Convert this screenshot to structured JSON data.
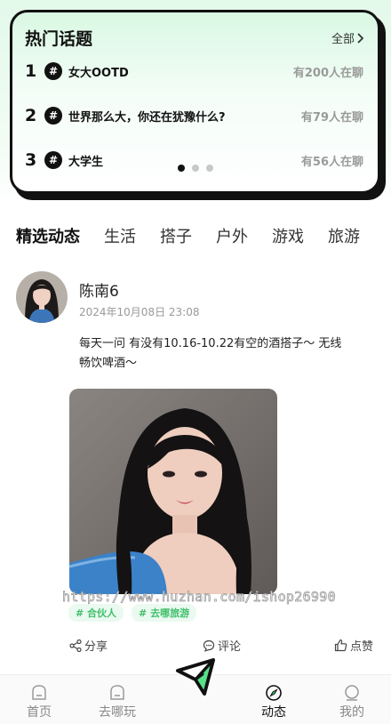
{
  "hot_topics": {
    "title": "热门话题",
    "all_label": "全部",
    "items": [
      {
        "rank": "1",
        "hash": "#",
        "name": "女大OOTD",
        "count": "有200人在聊"
      },
      {
        "rank": "2",
        "hash": "#",
        "name": "世界那么大，你还在犹豫什么?",
        "count": "有79人在聊"
      },
      {
        "rank": "3",
        "hash": "#",
        "name": "大学生",
        "count": "有56人在聊"
      }
    ],
    "carousel_pages": 3,
    "carousel_active": 1
  },
  "tabs": [
    {
      "label": "精选动态",
      "active": true
    },
    {
      "label": "生活",
      "active": false
    },
    {
      "label": "搭子",
      "active": false
    },
    {
      "label": "户外",
      "active": false
    },
    {
      "label": "游戏",
      "active": false
    },
    {
      "label": "旅游",
      "active": false
    }
  ],
  "post": {
    "author": "陈南6",
    "time": "2024年10月08日 23:08",
    "content": "每天一问 有没有10.16-10.22有空的酒搭子～ 无线畅饮啤酒～",
    "watermark": "https://www.huzhan.com/ishop26990",
    "tags": [
      "# 合伙人",
      "# 去哪旅游"
    ],
    "actions": {
      "share": "分享",
      "comment": "评论",
      "like": "点赞"
    }
  },
  "nav": {
    "items": [
      {
        "label": "首页",
        "icon": "home-icon",
        "active": false
      },
      {
        "label": "去哪玩",
        "icon": "explore-icon",
        "active": false
      },
      {
        "label": "动态",
        "icon": "compass-icon",
        "active": true
      },
      {
        "label": "我的",
        "icon": "profile-icon",
        "active": false
      }
    ],
    "publish_icon": "send-icon"
  },
  "colors": {
    "accent": "#3fbf6a",
    "dark": "#111111",
    "muted": "#9a9a9a"
  }
}
